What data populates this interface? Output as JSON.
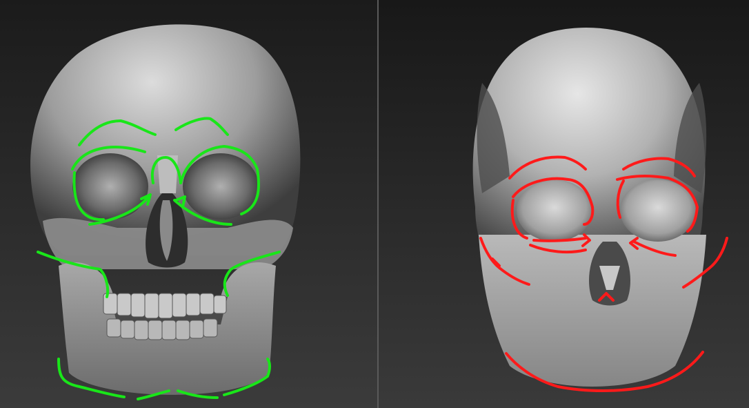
{
  "panels": [
    {
      "id": "left",
      "subject": "detailed-skull-sculpt",
      "annotation_color": "#19e619"
    },
    {
      "id": "right",
      "subject": "blocked-out-skull-sculpt",
      "annotation_color": "#ff1a1a"
    }
  ],
  "colors": {
    "background_top": "#1c1c1c",
    "background_bottom": "#3a3a3a",
    "divider": "#5a5a5a",
    "bone_light": "#d8d8d8",
    "bone_mid": "#9a9a9a",
    "bone_dark": "#3c3c3c"
  }
}
